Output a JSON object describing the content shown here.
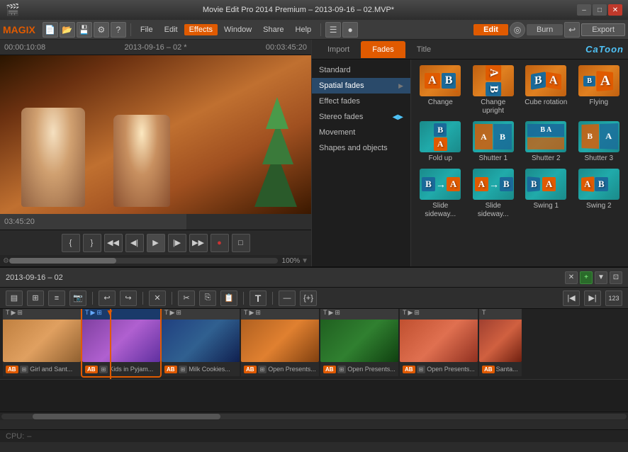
{
  "titlebar": {
    "title": "Movie Edit Pro 2014 Premium – 2013-09-16 – 02.MVP*",
    "minimize": "–",
    "maximize": "□",
    "close": "✕"
  },
  "menubar": {
    "logo": "MAGIX",
    "items": [
      "File",
      "Edit",
      "Effects",
      "Window",
      "Share",
      "Help"
    ],
    "edit_btn": "Edit",
    "burn_btn": "Burn",
    "export_btn": "Export"
  },
  "preview": {
    "timecode_start": "00:00:10:08",
    "timecode_file": "2013-09-16 – 02 *",
    "timecode_end": "00:03:45:20",
    "position": "03:45:20",
    "zoom": "100%"
  },
  "effects": {
    "tabs": [
      "Import",
      "Fades",
      "Title"
    ],
    "active_tab": "Fades",
    "catoon": "CaToon",
    "sidebar_items": [
      {
        "label": "Standard",
        "arrow": false
      },
      {
        "label": "Spatial fades",
        "arrow": true
      },
      {
        "label": "Effect fades",
        "arrow": false
      },
      {
        "label": "Stereo fades",
        "arrow": false
      },
      {
        "label": "Movement",
        "arrow": false
      },
      {
        "label": "Shapes and objects",
        "arrow": false
      }
    ],
    "grid_items": [
      {
        "label": "Change",
        "type": "orange"
      },
      {
        "label": "Change upright",
        "type": "orange"
      },
      {
        "label": "Cube rotation",
        "type": "orange"
      },
      {
        "label": "Flying",
        "type": "orange"
      },
      {
        "label": "Fold up",
        "type": "teal"
      },
      {
        "label": "Shutter 1",
        "type": "teal"
      },
      {
        "label": "Shutter 2",
        "type": "teal"
      },
      {
        "label": "Shutter 3",
        "type": "teal"
      },
      {
        "label": "Slide sideway...",
        "type": "teal"
      },
      {
        "label": "Slide sideway...",
        "type": "teal"
      },
      {
        "label": "Swing 1",
        "type": "teal"
      },
      {
        "label": "Swing 2",
        "type": "teal"
      }
    ]
  },
  "timeline": {
    "title": "2013-09-16 – 02",
    "clips": [
      {
        "name": "Girl and Sant...",
        "color": "warm"
      },
      {
        "name": "Kids in Pyjam...",
        "color": "warm",
        "selected": true
      },
      {
        "name": "Milk Cookies...",
        "color": "cool"
      },
      {
        "name": "Open Presents...",
        "color": "warm"
      },
      {
        "name": "Open Presents...",
        "color": "green"
      },
      {
        "name": "Open Presents...",
        "color": "warm"
      },
      {
        "name": "Santa...",
        "color": "warm"
      }
    ]
  },
  "statusbar": {
    "cpu_label": "CPU:",
    "cpu_value": "–"
  }
}
